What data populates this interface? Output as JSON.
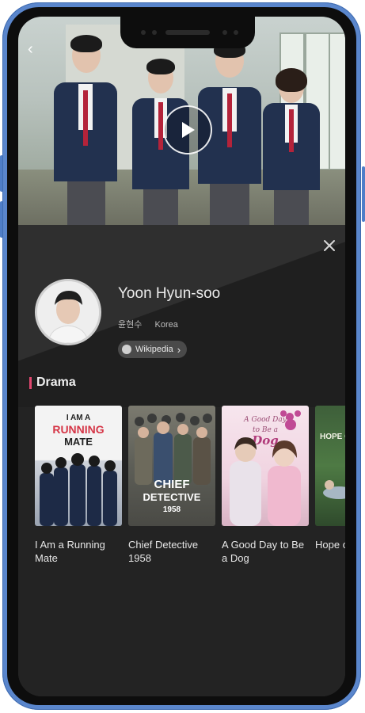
{
  "hero": {
    "play_label": "play"
  },
  "profile": {
    "name": "Yoon Hyun-soo",
    "native_name": "윤현수",
    "country": "Korea",
    "wiki_label": "Wikipedia"
  },
  "section": {
    "title": "Drama"
  },
  "posters": [
    {
      "art_lines": [
        "I AM A",
        "RUNNING",
        "MATE"
      ]
    },
    {
      "art_lines": [
        "CHIEF",
        "DETECTIVE",
        "1958"
      ]
    },
    {
      "art_lines": [
        "A Good Day",
        "to Be a",
        "Dog"
      ]
    },
    {
      "art_lines": [
        "HOPE O"
      ]
    }
  ],
  "dramas": [
    {
      "title": "I Am a Running Mate"
    },
    {
      "title": "Chief Detective 1958"
    },
    {
      "title": "A Good Day to Be a Dog"
    },
    {
      "title": "Hope or"
    }
  ],
  "colors": {
    "accent": "#e0476f",
    "phone_frame": "#5a86cc",
    "panel_bg": "#232323"
  }
}
